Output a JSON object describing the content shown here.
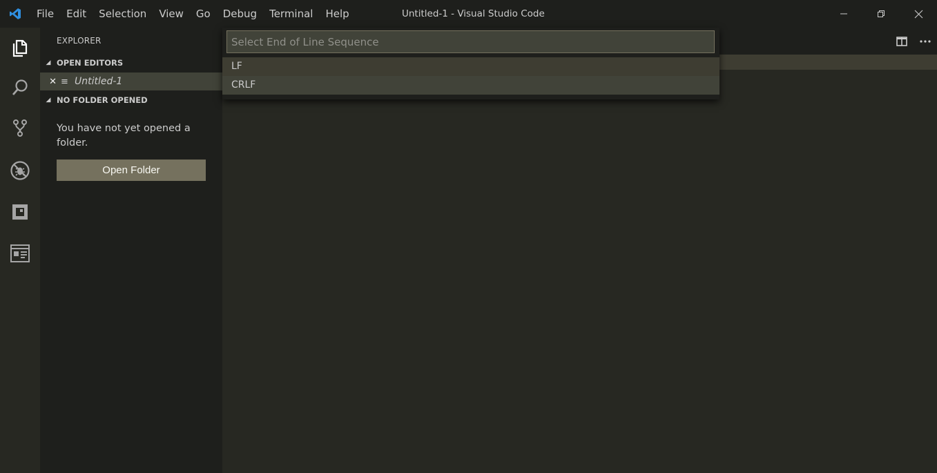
{
  "titlebar": {
    "menu": [
      "File",
      "Edit",
      "Selection",
      "View",
      "Go",
      "Debug",
      "Terminal",
      "Help"
    ],
    "window_title": "Untitled-1 - Visual Studio Code"
  },
  "sidebar": {
    "title": "EXPLORER",
    "open_editors_label": "OPEN EDITORS",
    "open_editor_file": "Untitled-1",
    "no_folder_label": "NO FOLDER OPENED",
    "empty_message": "You have not yet opened a folder.",
    "open_folder_button": "Open Folder"
  },
  "quickpick": {
    "placeholder": "Select End of Line Sequence",
    "items": [
      "LF",
      "CRLF"
    ]
  },
  "colors": {
    "accent": "#75715e",
    "logo_blue": "#2f8fe0"
  }
}
